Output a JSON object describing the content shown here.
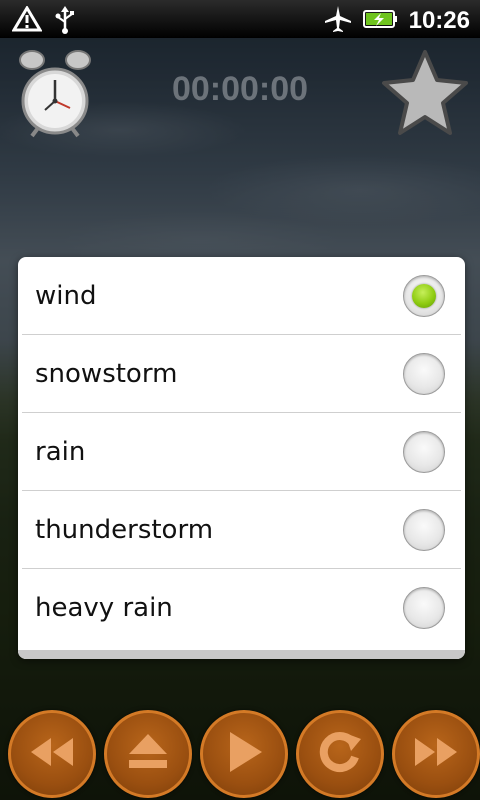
{
  "status_bar": {
    "time": "10:26",
    "left_icons": [
      "warning-icon",
      "usb-icon"
    ],
    "right_icons": [
      "airplane-icon",
      "battery-charging-icon"
    ]
  },
  "header": {
    "timer": "00:00:00",
    "left_icon": "alarm-clock-icon",
    "right_icon": "star-icon"
  },
  "dialog": {
    "options": [
      {
        "label": "wind",
        "selected": true
      },
      {
        "label": "snowstorm",
        "selected": false
      },
      {
        "label": "rain",
        "selected": false
      },
      {
        "label": "thunderstorm",
        "selected": false
      },
      {
        "label": "heavy rain",
        "selected": false
      }
    ]
  },
  "controls": [
    {
      "icon": "rewind-icon"
    },
    {
      "icon": "eject-icon"
    },
    {
      "icon": "play-icon"
    },
    {
      "icon": "repeat-icon"
    },
    {
      "icon": "fast-forward-icon"
    }
  ],
  "colors": {
    "radio_selected": "#8fcc12",
    "control_button": "#9a4f10",
    "timer_text": "#6c737a"
  }
}
